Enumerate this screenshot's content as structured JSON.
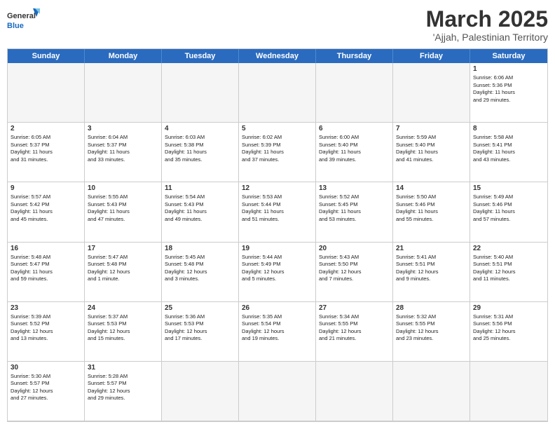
{
  "header": {
    "logo_general": "General",
    "logo_blue": "Blue",
    "month_year": "March 2025",
    "location": "'Ajjah, Palestinian Territory"
  },
  "days_of_week": [
    "Sunday",
    "Monday",
    "Tuesday",
    "Wednesday",
    "Thursday",
    "Friday",
    "Saturday"
  ],
  "cells": [
    {
      "day": "",
      "empty": true,
      "info": ""
    },
    {
      "day": "",
      "empty": true,
      "info": ""
    },
    {
      "day": "",
      "empty": true,
      "info": ""
    },
    {
      "day": "",
      "empty": true,
      "info": ""
    },
    {
      "day": "",
      "empty": true,
      "info": ""
    },
    {
      "day": "",
      "empty": true,
      "info": ""
    },
    {
      "day": "1",
      "empty": false,
      "info": "Sunrise: 6:06 AM\nSunset: 5:36 PM\nDaylight: 11 hours\nand 29 minutes."
    },
    {
      "day": "2",
      "empty": false,
      "info": "Sunrise: 6:05 AM\nSunset: 5:37 PM\nDaylight: 11 hours\nand 31 minutes."
    },
    {
      "day": "3",
      "empty": false,
      "info": "Sunrise: 6:04 AM\nSunset: 5:37 PM\nDaylight: 11 hours\nand 33 minutes."
    },
    {
      "day": "4",
      "empty": false,
      "info": "Sunrise: 6:03 AM\nSunset: 5:38 PM\nDaylight: 11 hours\nand 35 minutes."
    },
    {
      "day": "5",
      "empty": false,
      "info": "Sunrise: 6:02 AM\nSunset: 5:39 PM\nDaylight: 11 hours\nand 37 minutes."
    },
    {
      "day": "6",
      "empty": false,
      "info": "Sunrise: 6:00 AM\nSunset: 5:40 PM\nDaylight: 11 hours\nand 39 minutes."
    },
    {
      "day": "7",
      "empty": false,
      "info": "Sunrise: 5:59 AM\nSunset: 5:40 PM\nDaylight: 11 hours\nand 41 minutes."
    },
    {
      "day": "8",
      "empty": false,
      "info": "Sunrise: 5:58 AM\nSunset: 5:41 PM\nDaylight: 11 hours\nand 43 minutes."
    },
    {
      "day": "9",
      "empty": false,
      "info": "Sunrise: 5:57 AM\nSunset: 5:42 PM\nDaylight: 11 hours\nand 45 minutes."
    },
    {
      "day": "10",
      "empty": false,
      "info": "Sunrise: 5:55 AM\nSunset: 5:43 PM\nDaylight: 11 hours\nand 47 minutes."
    },
    {
      "day": "11",
      "empty": false,
      "info": "Sunrise: 5:54 AM\nSunset: 5:43 PM\nDaylight: 11 hours\nand 49 minutes."
    },
    {
      "day": "12",
      "empty": false,
      "info": "Sunrise: 5:53 AM\nSunset: 5:44 PM\nDaylight: 11 hours\nand 51 minutes."
    },
    {
      "day": "13",
      "empty": false,
      "info": "Sunrise: 5:52 AM\nSunset: 5:45 PM\nDaylight: 11 hours\nand 53 minutes."
    },
    {
      "day": "14",
      "empty": false,
      "info": "Sunrise: 5:50 AM\nSunset: 5:46 PM\nDaylight: 11 hours\nand 55 minutes."
    },
    {
      "day": "15",
      "empty": false,
      "info": "Sunrise: 5:49 AM\nSunset: 5:46 PM\nDaylight: 11 hours\nand 57 minutes."
    },
    {
      "day": "16",
      "empty": false,
      "info": "Sunrise: 5:48 AM\nSunset: 5:47 PM\nDaylight: 11 hours\nand 59 minutes."
    },
    {
      "day": "17",
      "empty": false,
      "info": "Sunrise: 5:47 AM\nSunset: 5:48 PM\nDaylight: 12 hours\nand 1 minute."
    },
    {
      "day": "18",
      "empty": false,
      "info": "Sunrise: 5:45 AM\nSunset: 5:48 PM\nDaylight: 12 hours\nand 3 minutes."
    },
    {
      "day": "19",
      "empty": false,
      "info": "Sunrise: 5:44 AM\nSunset: 5:49 PM\nDaylight: 12 hours\nand 5 minutes."
    },
    {
      "day": "20",
      "empty": false,
      "info": "Sunrise: 5:43 AM\nSunset: 5:50 PM\nDaylight: 12 hours\nand 7 minutes."
    },
    {
      "day": "21",
      "empty": false,
      "info": "Sunrise: 5:41 AM\nSunset: 5:51 PM\nDaylight: 12 hours\nand 9 minutes."
    },
    {
      "day": "22",
      "empty": false,
      "info": "Sunrise: 5:40 AM\nSunset: 5:51 PM\nDaylight: 12 hours\nand 11 minutes."
    },
    {
      "day": "23",
      "empty": false,
      "info": "Sunrise: 5:39 AM\nSunset: 5:52 PM\nDaylight: 12 hours\nand 13 minutes."
    },
    {
      "day": "24",
      "empty": false,
      "info": "Sunrise: 5:37 AM\nSunset: 5:53 PM\nDaylight: 12 hours\nand 15 minutes."
    },
    {
      "day": "25",
      "empty": false,
      "info": "Sunrise: 5:36 AM\nSunset: 5:53 PM\nDaylight: 12 hours\nand 17 minutes."
    },
    {
      "day": "26",
      "empty": false,
      "info": "Sunrise: 5:35 AM\nSunset: 5:54 PM\nDaylight: 12 hours\nand 19 minutes."
    },
    {
      "day": "27",
      "empty": false,
      "info": "Sunrise: 5:34 AM\nSunset: 5:55 PM\nDaylight: 12 hours\nand 21 minutes."
    },
    {
      "day": "28",
      "empty": false,
      "info": "Sunrise: 5:32 AM\nSunset: 5:55 PM\nDaylight: 12 hours\nand 23 minutes."
    },
    {
      "day": "29",
      "empty": false,
      "info": "Sunrise: 5:31 AM\nSunset: 5:56 PM\nDaylight: 12 hours\nand 25 minutes."
    },
    {
      "day": "30",
      "empty": false,
      "info": "Sunrise: 5:30 AM\nSunset: 5:57 PM\nDaylight: 12 hours\nand 27 minutes."
    },
    {
      "day": "31",
      "empty": false,
      "info": "Sunrise: 5:28 AM\nSunset: 5:57 PM\nDaylight: 12 hours\nand 29 minutes."
    },
    {
      "day": "",
      "empty": true,
      "info": ""
    },
    {
      "day": "",
      "empty": true,
      "info": ""
    },
    {
      "day": "",
      "empty": true,
      "info": ""
    },
    {
      "day": "",
      "empty": true,
      "info": ""
    },
    {
      "day": "",
      "empty": true,
      "info": ""
    }
  ]
}
